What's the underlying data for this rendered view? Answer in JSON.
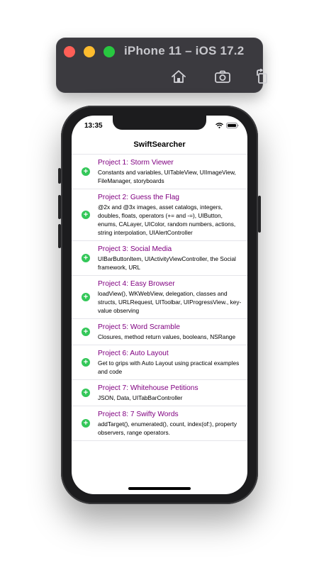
{
  "simulator": {
    "title": "iPhone 11 – iOS 17.2",
    "icons": [
      "home-icon",
      "screenshot-icon",
      "rotate-icon"
    ]
  },
  "status_bar": {
    "time": "13:35",
    "icons": [
      "wifi-icon",
      "battery-icon"
    ]
  },
  "app": {
    "title": "SwiftSearcher"
  },
  "colors": {
    "title_accent": "#800080",
    "add_icon": "#34c759",
    "traffic_close": "#ff5f57",
    "traffic_min": "#febc2e",
    "traffic_max": "#28c840"
  },
  "projects": [
    {
      "title": "Project 1: Storm Viewer",
      "subtitle": "Constants and variables, UITableView, UIImageView, FileManager, storyboards"
    },
    {
      "title": "Project 2: Guess the Flag",
      "subtitle": "@2x and @3x images, asset catalogs, integers, doubles, floats, operators (+= and -=), UIButton, enums, CALayer, UIColor, random numbers, actions, string interpolation, UIAlertController"
    },
    {
      "title": "Project 3: Social Media",
      "subtitle": "UIBarButtonItem, UIActivityViewController, the Social framework, URL"
    },
    {
      "title": "Project 4: Easy Browser",
      "subtitle": "loadView(), WKWebView, delegation, classes and structs, URLRequest, UIToolbar, UIProgressView., key-value observing"
    },
    {
      "title": "Project 5: Word Scramble",
      "subtitle": "Closures, method return values, booleans, NSRange"
    },
    {
      "title": "Project 6: Auto Layout",
      "subtitle": "Get to grips with Auto Layout using practical examples and code"
    },
    {
      "title": "Project 7: Whitehouse Petitions",
      "subtitle": "JSON, Data, UITabBarController"
    },
    {
      "title": "Project 8: 7 Swifty Words",
      "subtitle": "addTarget(), enumerated(), count, index(of:), property observers, range operators."
    }
  ]
}
